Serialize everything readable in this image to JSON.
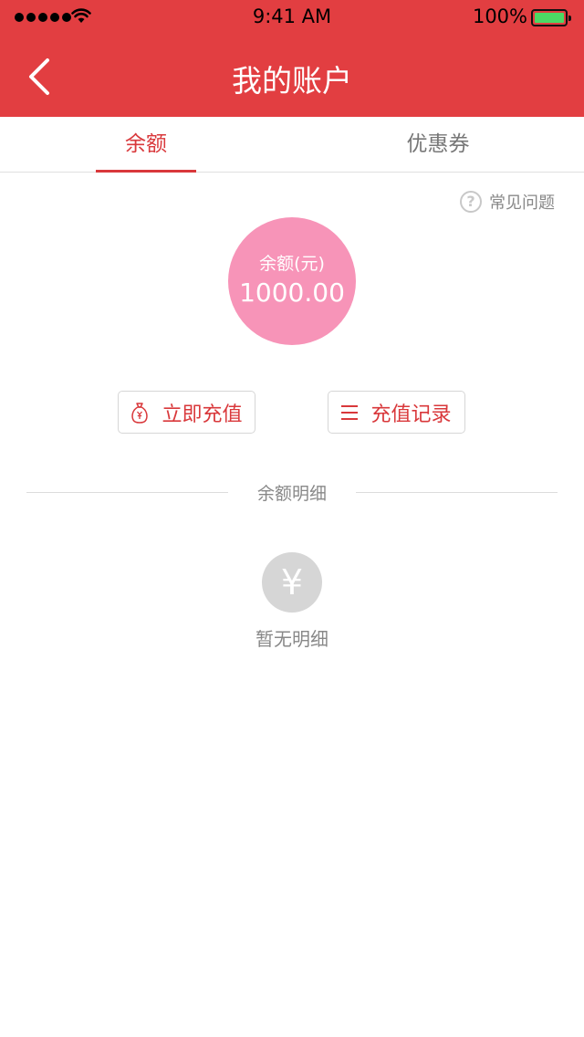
{
  "status_bar": {
    "time": "9:41 AM",
    "battery_percent": "100%",
    "battery_color": "#4cd964"
  },
  "nav": {
    "title": "我的账户",
    "back_icon": "chevron-left-icon",
    "bg_color": "#e23e41"
  },
  "tabs": [
    {
      "label": "余额",
      "active": true
    },
    {
      "label": "优惠券",
      "active": false
    }
  ],
  "faq": {
    "label": "常见问题",
    "icon": "question-circle-icon"
  },
  "balance": {
    "label": "余额(元)",
    "value": "1000.00",
    "circle_color": "#f794b8"
  },
  "actions": {
    "recharge": {
      "label": "立即充值",
      "icon": "money-bag-icon"
    },
    "records": {
      "label": "充值记录",
      "icon": "list-icon"
    }
  },
  "details": {
    "section_title": "余额明细",
    "empty_icon": "yen-icon",
    "empty_icon_glyph": "¥",
    "empty_text": "暂无明细"
  },
  "accent_color": "#d9383b"
}
